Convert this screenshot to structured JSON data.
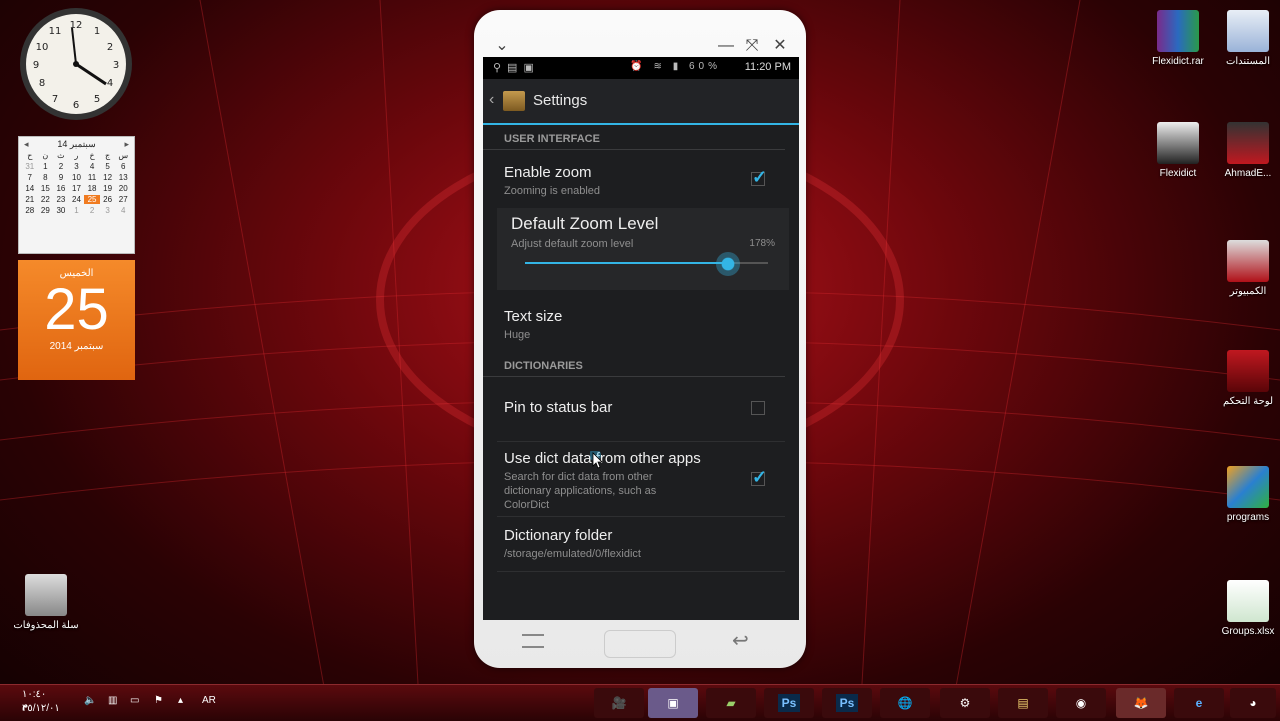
{
  "gadgets": {
    "calendar": {
      "month_header": "سبتمبر 14",
      "weekdays": [
        "ح",
        "ن",
        "ث",
        "ر",
        "خ",
        "ج",
        "س"
      ],
      "weeks": [
        [
          "31",
          "1",
          "2",
          "3",
          "4",
          "5",
          "6"
        ],
        [
          "7",
          "8",
          "9",
          "10",
          "11",
          "12",
          "13"
        ],
        [
          "14",
          "15",
          "16",
          "17",
          "18",
          "19",
          "20"
        ],
        [
          "21",
          "22",
          "23",
          "24",
          "25",
          "26",
          "27"
        ],
        [
          "28",
          "29",
          "30",
          "1",
          "2",
          "3",
          "4"
        ]
      ],
      "today_weekday": "الخميس",
      "today_day": "25",
      "today_month_year": "سبتمبر 2014"
    }
  },
  "desktop_icons": {
    "flexidict_rar": "Flexidict.rar",
    "documents": "المستندات",
    "flexidict": "Flexidict",
    "ahmad": "AhmadE...",
    "computer": "الكمبيوتر",
    "control_panel": "لوحة التحكم",
    "programs": "programs",
    "recycle_bin": "سلة المحذوفات",
    "groups_xlsx": "Groups.xlsx"
  },
  "phone": {
    "status_time": "11:20 PM",
    "status_battery": "60%",
    "actionbar_title": "Settings",
    "section_ui": "USER INTERFACE",
    "enable_zoom": {
      "title": "Enable zoom",
      "summary": "Zooming is enabled",
      "checked": true
    },
    "zoom_level": {
      "title": "Default Zoom Level",
      "summary": "Adjust default zoom level",
      "value": "178%",
      "slider_fraction": 0.83
    },
    "text_size": {
      "title": "Text size",
      "summary": "Huge"
    },
    "section_dict": "DICTIONARIES",
    "pin_status": {
      "title": "Pin to status bar",
      "checked": false
    },
    "use_dict": {
      "title": "Use dict data from other apps",
      "summary": "Search for dict data from other dictionary applications, such as ColorDict",
      "checked": true
    },
    "dict_folder": {
      "title": "Dictionary folder",
      "summary": "/storage/emulated/0/flexidict"
    }
  },
  "taskbar": {
    "lang": "AR",
    "time": "١٠:٤٠ م",
    "date": "٢٥/١٢/٠١"
  },
  "colors": {
    "accent": "#33b5e5",
    "desktop_red": "#b0121a"
  }
}
